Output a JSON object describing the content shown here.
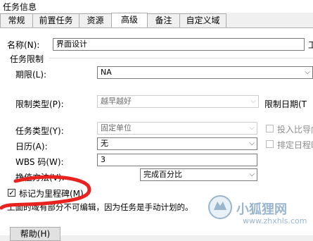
{
  "window": {
    "title": "任务信息"
  },
  "tabs": [
    {
      "label": "常规",
      "active": false
    },
    {
      "label": "前置任务",
      "active": false
    },
    {
      "label": "资源",
      "active": false
    },
    {
      "label": "高级",
      "active": true
    },
    {
      "label": "备注",
      "active": false
    },
    {
      "label": "自定义域",
      "active": false
    }
  ],
  "form": {
    "name_label": "名称(N):",
    "name_value": "界面设计",
    "constraint_group": "任务限制",
    "deadline_label": "期限(L):",
    "deadline_value": "NA",
    "constraint_type_label": "限制类型(P):",
    "constraint_type_value": "越早越好",
    "constraint_date_label": "限制日期(T",
    "task_type_label": "任务类型(Y):",
    "task_type_value": "固定单位",
    "effort_driven_label": "投入比导向",
    "calendar_label": "日历(A):",
    "calendar_value": "无",
    "ignore_calendar_label": "排定日程时",
    "wbs_label": "WBS 码(W):",
    "wbs_value": "3",
    "earned_value_label": "挣值方法(V):",
    "earned_value_value": "完成百分比",
    "milestone_label": "标记为里程碑(M)",
    "milestone_checked": true,
    "note_text": "上面的域有部分不可编辑，因为任务是手动计划的。",
    "help_button": "帮助(H)"
  },
  "watermark": {
    "main": "小狐狸网",
    "sub": "www.zhxhls.com"
  },
  "colors": {
    "annotation_red": "#e8231f",
    "watermark": "#9ab6cc"
  }
}
